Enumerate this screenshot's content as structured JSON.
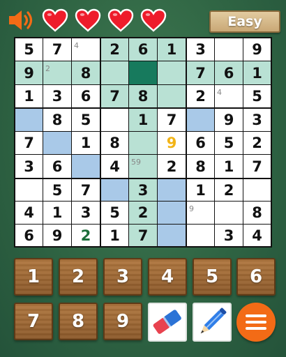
{
  "header": {
    "sound_icon": "speaker-icon",
    "lives": 4,
    "difficulty": "Easy"
  },
  "colors": {
    "highlight_region": "#b9e1d4",
    "highlight_same_digit": "#a9c9e8",
    "selected_cell": "#177a5d",
    "conflict_digit": "#f2b417",
    "user_digit": "#1c6e3a",
    "note_digit": "#888888",
    "pad_wood": "#9b6534",
    "menu_orange": "#f36b16"
  },
  "board": {
    "rows": [
      [
        "5",
        "7",
        "",
        "2",
        "6",
        "1",
        "3",
        "",
        "9"
      ],
      [
        "9",
        "",
        "8",
        "",
        "",
        "",
        "7",
        "6",
        "1"
      ],
      [
        "1",
        "3",
        "6",
        "7",
        "8",
        "",
        "2",
        "",
        "5"
      ],
      [
        "",
        "8",
        "5",
        "",
        "1",
        "7",
        "",
        "9",
        "3"
      ],
      [
        "7",
        "",
        "1",
        "8",
        "",
        "9",
        "6",
        "5",
        "2"
      ],
      [
        "3",
        "6",
        "",
        "4",
        "",
        "2",
        "8",
        "1",
        "7"
      ],
      [
        "",
        "5",
        "7",
        "",
        "3",
        "",
        "1",
        "2",
        ""
      ],
      [
        "4",
        "1",
        "3",
        "5",
        "2",
        "",
        "",
        "",
        "8"
      ],
      [
        "6",
        "9",
        "2",
        "1",
        "7",
        "",
        "",
        "3",
        "4"
      ]
    ],
    "notes": [
      [
        "",
        "",
        "4",
        "",
        "",
        "",
        "",
        "",
        ""
      ],
      [
        "",
        "2",
        "",
        "",
        "",
        "",
        "",
        "",
        ""
      ],
      [
        "",
        "",
        "",
        "",
        "",
        "",
        "",
        "4",
        ""
      ],
      [
        "",
        "",
        "",
        "",
        "",
        "",
        "",
        "",
        ""
      ],
      [
        "",
        "",
        "",
        "",
        "",
        "",
        "",
        "",
        ""
      ],
      [
        "",
        "",
        "",
        "",
        "59",
        "",
        "",
        "",
        ""
      ],
      [
        "",
        "",
        "",
        "",
        "",
        "",
        "",
        "",
        ""
      ],
      [
        "",
        "",
        "",
        "",
        "",
        "",
        "9",
        "",
        ""
      ],
      [
        "",
        "",
        "",
        "",
        "",
        "",
        "",
        "",
        ""
      ]
    ],
    "highlight": [
      [
        "w",
        "w",
        "w",
        "g",
        "g",
        "g",
        "w",
        "w",
        "w"
      ],
      [
        "g",
        "g",
        "g",
        "g",
        "S",
        "g",
        "g",
        "g",
        "g"
      ],
      [
        "w",
        "w",
        "w",
        "g",
        "g",
        "g",
        "w",
        "w",
        "w"
      ],
      [
        "b",
        "w",
        "w",
        "w",
        "g",
        "w",
        "b",
        "w",
        "w"
      ],
      [
        "w",
        "b",
        "w",
        "w",
        "g",
        "w",
        "w",
        "w",
        "w"
      ],
      [
        "w",
        "w",
        "b",
        "w",
        "g",
        "w",
        "w",
        "w",
        "w"
      ],
      [
        "w",
        "w",
        "w",
        "b",
        "g",
        "b",
        "w",
        "w",
        "w"
      ],
      [
        "w",
        "w",
        "w",
        "w",
        "g",
        "b",
        "w",
        "w",
        "w"
      ],
      [
        "w",
        "w",
        "w",
        "w",
        "g",
        "b",
        "w",
        "w",
        "w"
      ]
    ],
    "conflict_cell": [
      4,
      5
    ],
    "user_cells": [
      [
        8,
        2
      ]
    ]
  },
  "numpad": [
    "1",
    "2",
    "3",
    "4",
    "5",
    "6",
    "7",
    "8",
    "9"
  ],
  "tools": {
    "eraser_icon": "eraser-icon",
    "pencil_icon": "pencil-icon",
    "menu_icon": "hamburger-menu-icon"
  }
}
